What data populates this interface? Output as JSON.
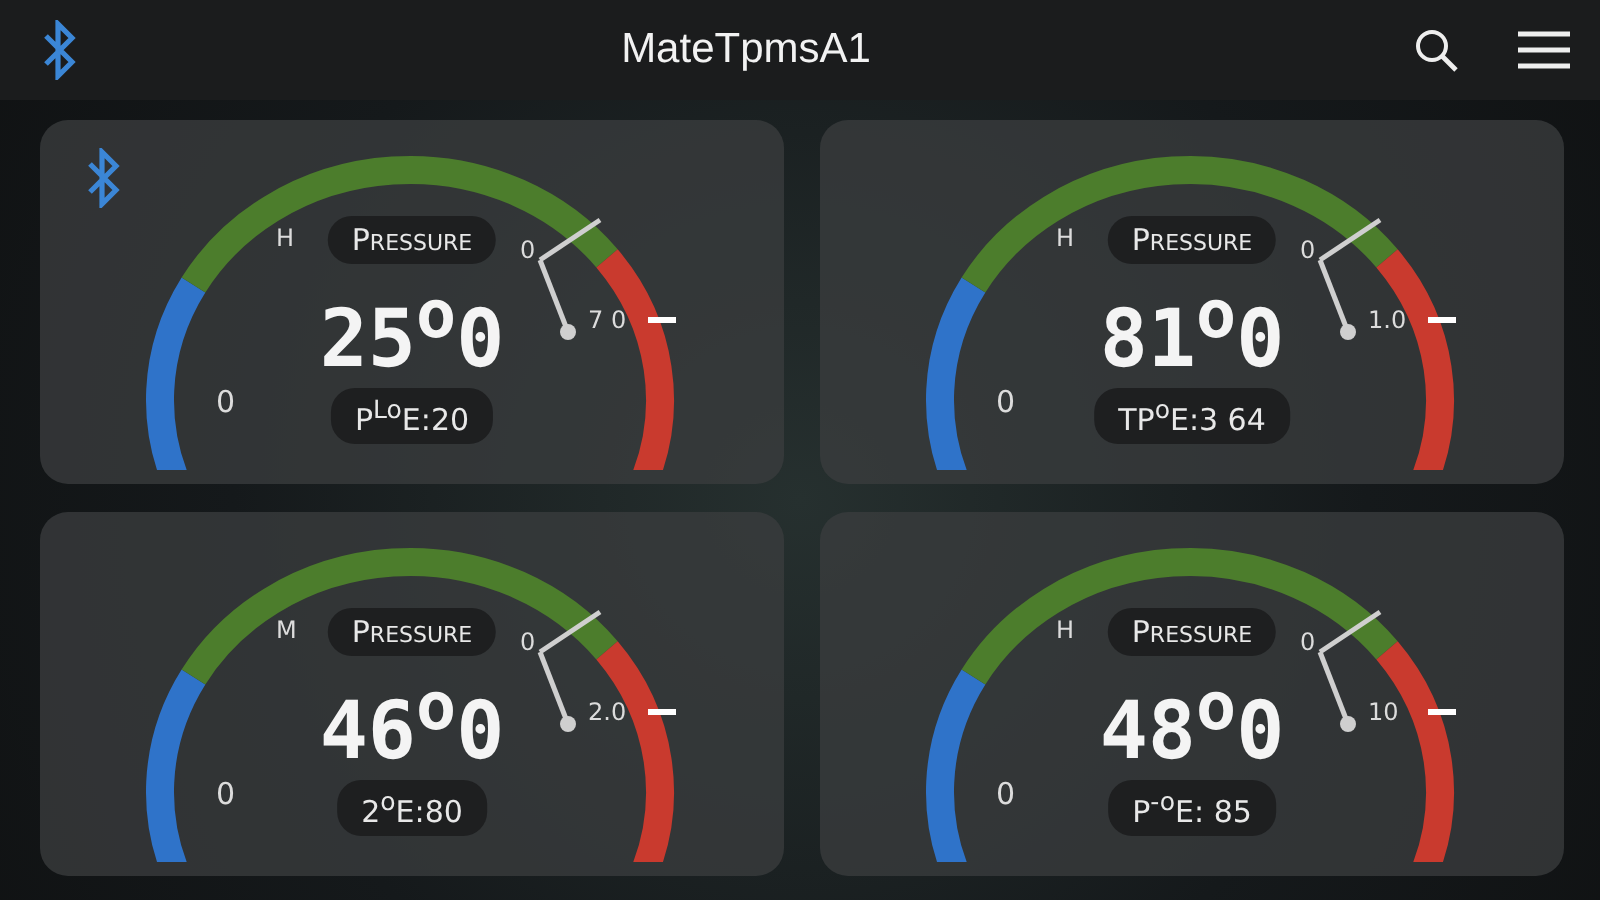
{
  "header": {
    "title": "MateTpmsA1"
  },
  "gauges": [
    {
      "bluetooth": true,
      "label": "Pressure",
      "value": "25$^{o}$0",
      "detail": "P$^{Lo}$E:20",
      "mid_mark": "H",
      "needle_mark": "0",
      "min_label": "0",
      "max_label": "7 0"
    },
    {
      "bluetooth": false,
      "label": "Pressure",
      "value": "81$^{o}$0",
      "detail": "TP$^{o}$E:3 64",
      "mid_mark": "H",
      "needle_mark": "0",
      "min_label": "0",
      "max_label": "1.0"
    },
    {
      "bluetooth": false,
      "label": "Pressure",
      "value": "46$^{o}$0",
      "detail": "2$^{o}$E:80",
      "mid_mark": "M",
      "needle_mark": "0",
      "min_label": "0",
      "max_label": "2.0"
    },
    {
      "bluetooth": false,
      "label": "Pressure",
      "value": "48$^{o}$0",
      "detail": "P$^{-o}$E: 85",
      "mid_mark": "H",
      "needle_mark": "0",
      "min_label": "0",
      "max_label": "10"
    }
  ]
}
